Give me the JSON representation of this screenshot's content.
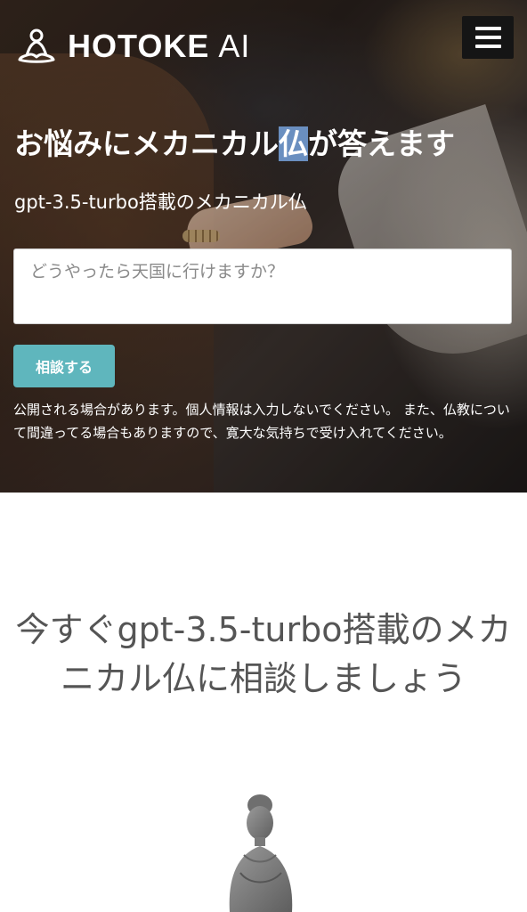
{
  "header": {
    "logo_text_bold": "HOTOKE",
    "logo_text_light": "AI",
    "logo_icon": "meditating-figure-icon",
    "menu_icon": "hamburger-menu-icon"
  },
  "hero": {
    "headline_before": "お悩みにメカニカル",
    "headline_selected": "仏",
    "headline_after": "が答えます",
    "subline": "gpt-3.5-turbo搭載のメカニカル仏",
    "question_placeholder": "どうやったら天国に行けますか？",
    "question_value": "",
    "consult_button_label": "相談する",
    "notice": "公開される場合があります。個人情報は入力しないでください。 また、仏教について間違ってる場合もありますので、寛大な気持ちで受け入れてください。"
  },
  "cta": {
    "heading": "今すぐgpt-3.5-turbo搭載のメカニカル仏に相談しましょう"
  },
  "colors": {
    "accent_button": "#5fb6bd",
    "menu_button_bg": "#151515",
    "heading_gray": "#555555",
    "selection_highlight": "#6a8fc0"
  }
}
